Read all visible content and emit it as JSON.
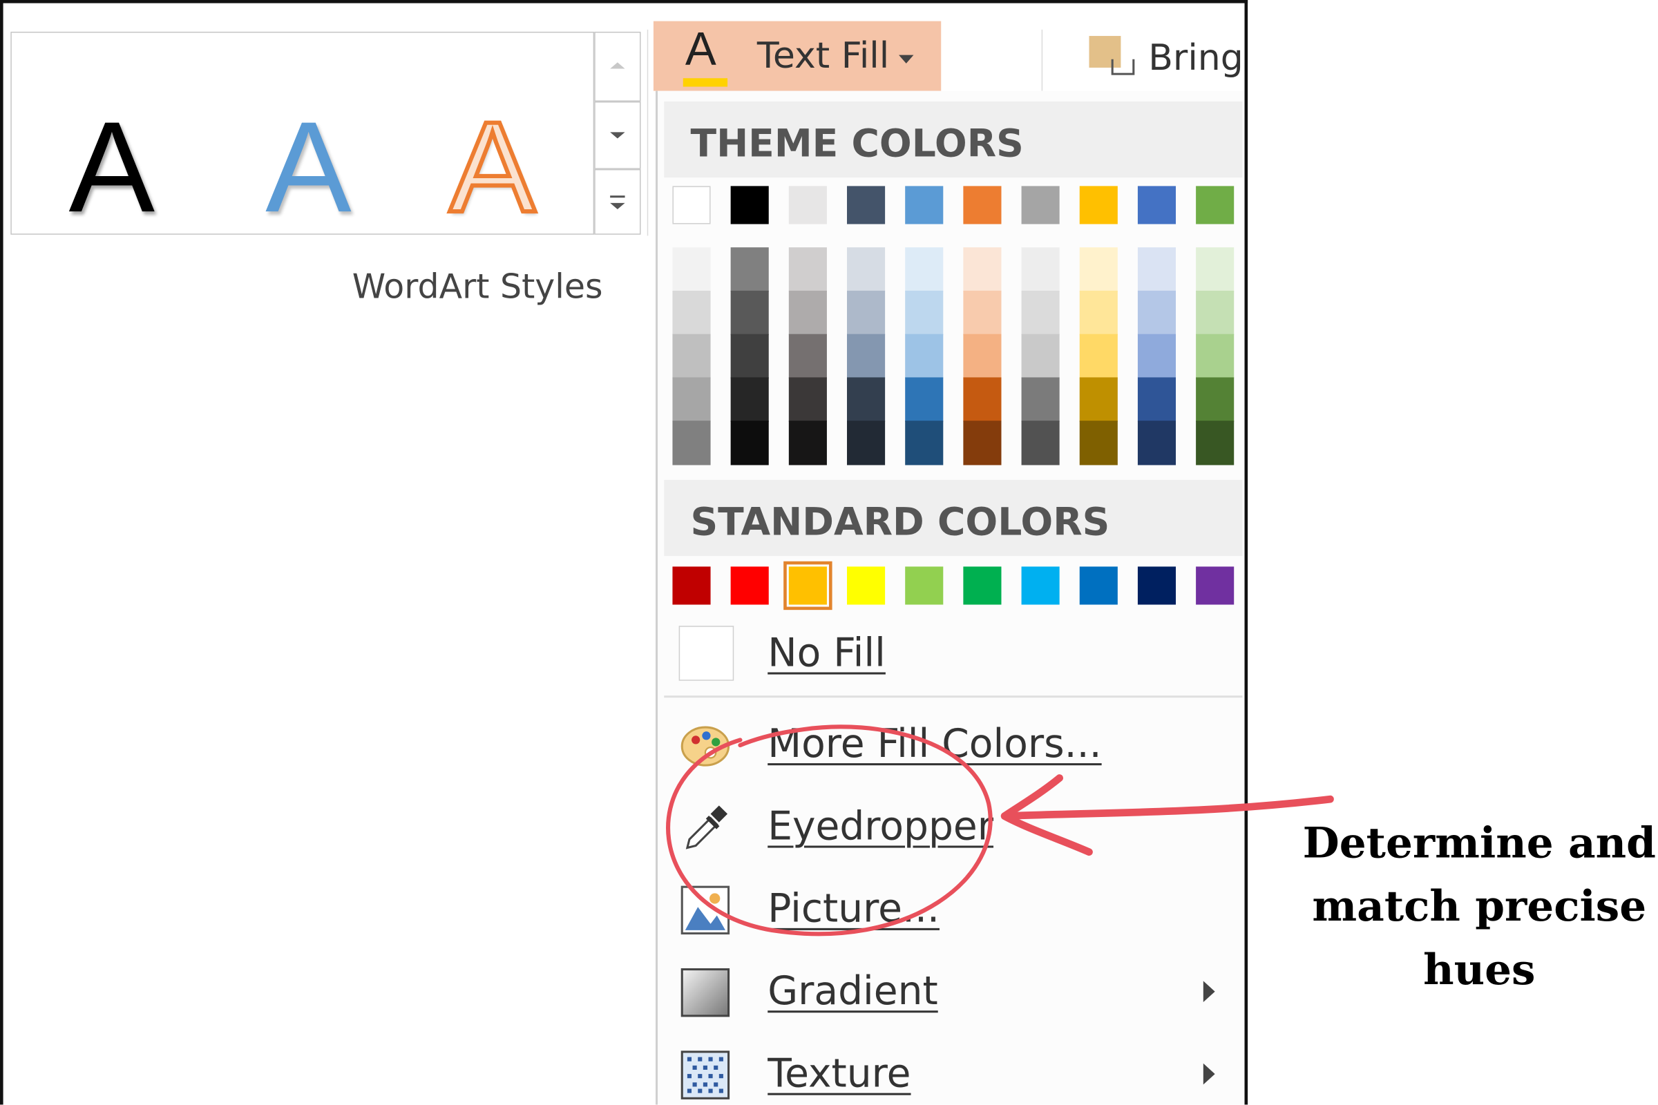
{
  "wordart_gallery": {
    "samples": [
      {
        "glyph": "A",
        "style": "black",
        "color": "#000000"
      },
      {
        "glyph": "A",
        "style": "blue",
        "color": "#5b9bd5"
      },
      {
        "glyph": "A",
        "style": "orange-outline",
        "color": "#ed7d31"
      }
    ],
    "group_label": "WordArt Styles"
  },
  "ribbon": {
    "text_fill": {
      "glyph": "A",
      "label": "Text Fill",
      "accent": "#f5c4a8",
      "underline_color": "#ffd200"
    },
    "bring_label": "Bring"
  },
  "dropdown": {
    "theme_colors_header": "THEME COLORS",
    "theme_colors": [
      "#ffffff",
      "#000000",
      "#e7e6e6",
      "#44546a",
      "#5b9bd5",
      "#ed7d31",
      "#a5a5a5",
      "#ffc000",
      "#4472c4",
      "#70ad47"
    ],
    "theme_shades": [
      [
        "#f2f2f2",
        "#d9d9d9",
        "#bfbfbf",
        "#a6a6a6",
        "#808080"
      ],
      [
        "#808080",
        "#595959",
        "#404040",
        "#262626",
        "#0d0d0d"
      ],
      [
        "#d0cece",
        "#aeabab",
        "#757070",
        "#3b3838",
        "#171616"
      ],
      [
        "#d6dce4",
        "#adb9ca",
        "#8497b0",
        "#333f4f",
        "#222a35"
      ],
      [
        "#ddebf7",
        "#bdd7ee",
        "#9dc3e6",
        "#2e75b6",
        "#1f4e79"
      ],
      [
        "#fbe5d6",
        "#f8cbad",
        "#f4b183",
        "#c55a11",
        "#843c0c"
      ],
      [
        "#ededed",
        "#dbdbdb",
        "#c9c9c9",
        "#7b7b7b",
        "#525252"
      ],
      [
        "#fff2cc",
        "#ffe699",
        "#ffd966",
        "#bf9000",
        "#7f6000"
      ],
      [
        "#dae3f3",
        "#b4c7e7",
        "#8faadc",
        "#2f5597",
        "#203864"
      ],
      [
        "#e2f0d9",
        "#c5e0b4",
        "#a9d18e",
        "#548235",
        "#385723"
      ]
    ],
    "standard_colors_header": "STANDARD COLORS",
    "standard_colors": [
      "#c00000",
      "#ff0000",
      "#ffc000",
      "#ffff00",
      "#92d050",
      "#00b050",
      "#00b0f0",
      "#0070c0",
      "#002060",
      "#7030a0"
    ],
    "selected_standard_index": 2,
    "items": [
      {
        "label": "No Fill",
        "icon": "no-fill-icon"
      },
      {
        "label": "More Fill Colors...",
        "icon": "palette-icon"
      },
      {
        "label": "Eyedropper",
        "icon": "eyedropper-icon"
      },
      {
        "label": "Picture...",
        "icon": "picture-icon"
      },
      {
        "label": "Gradient",
        "icon": "gradient-icon",
        "submenu": true
      },
      {
        "label": "Texture",
        "icon": "texture-icon",
        "submenu": true
      }
    ]
  },
  "annotation": {
    "text": "Determine and match precise hues",
    "line1": "Determine and",
    "line2": "match precise",
    "line3": "hues",
    "color": "#e8505b"
  }
}
